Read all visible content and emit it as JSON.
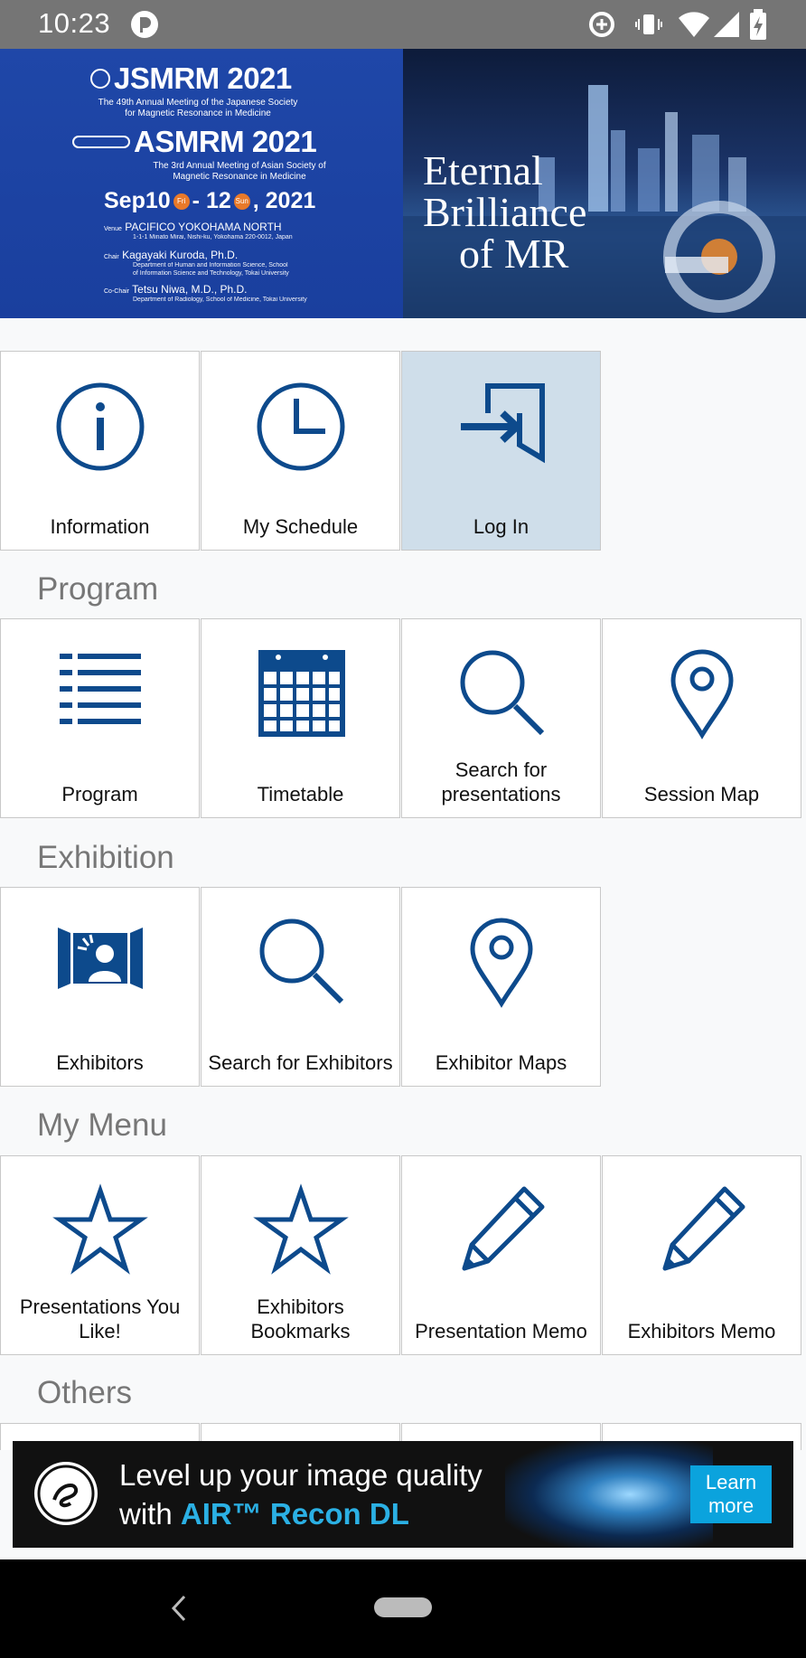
{
  "status_bar": {
    "time": "10:23"
  },
  "banner": {
    "title1": "JSMRM 2021",
    "subtitle1": "The 49th Annual Meeting of the Japanese Society for Magnetic Resonance in Medicine",
    "title2": "ASMRM 2021",
    "subtitle2": "The 3rd Annual Meeting of Asian Society of Magnetic Resonance in Medicine",
    "date_start": "Sep10",
    "day_start": "Fri",
    "date_mid": "- 12",
    "day_end": "Sun",
    "date_end": ", 2021",
    "venue_label": "Venue",
    "venue": "PACIFICO YOKOHAMA NORTH",
    "venue_address": "1-1-1 Minato Mirai, Nishi-ku, Yokohama 220-0012, Japan",
    "chair_label": "Chair",
    "chair": "Kagayaki Kuroda, Ph.D.",
    "chair_affiliation": "Department of Human and Information Science, School of Information Science and Technology, Tokai University",
    "cochair_label": "Co-Chair",
    "cochair": "Tetsu Niwa, M.D., Ph.D.",
    "cochair_affiliation": "Department of Radiology, School of Medicine, Tokai University",
    "tagline_1": "Eternal",
    "tagline_2": "Brilliance",
    "tagline_3": "of MR"
  },
  "top_menu": [
    {
      "label": "Information",
      "icon": "info-icon"
    },
    {
      "label": "My Schedule",
      "icon": "clock-icon"
    },
    {
      "label": "Log In",
      "icon": "login-icon",
      "active": true
    }
  ],
  "sections": {
    "program": {
      "title": "Program",
      "items": [
        {
          "label": "Program",
          "icon": "list-icon"
        },
        {
          "label": "Timetable",
          "icon": "calendar-icon"
        },
        {
          "label": "Search for presentations",
          "icon": "search-icon"
        },
        {
          "label": "Session Map",
          "icon": "map-pin-icon"
        }
      ]
    },
    "exhibition": {
      "title": "Exhibition",
      "items": [
        {
          "label": "Exhibitors",
          "icon": "exhibitor-booth-icon"
        },
        {
          "label": "Search for Exhibitors",
          "icon": "search-icon"
        },
        {
          "label": "Exhibitor Maps",
          "icon": "map-pin-icon"
        }
      ]
    },
    "my_menu": {
      "title": "My Menu",
      "items": [
        {
          "label": "Presentations You Like!",
          "icon": "star-icon"
        },
        {
          "label": "Exhibitors Bookmarks",
          "icon": "star-icon"
        },
        {
          "label": "Presentation Memo",
          "icon": "pencil-icon"
        },
        {
          "label": "Exhibitors Memo",
          "icon": "pencil-icon"
        }
      ]
    },
    "others": {
      "title": "Others"
    }
  },
  "ad": {
    "line1": "Level up your image quality",
    "line2_prefix": "with ",
    "line2_highlight": "AIR™ Recon DL",
    "cta": "Learn more"
  },
  "colors": {
    "icon_blue": "#0d4a8c",
    "tile_active_bg": "#cfdeea",
    "section_text": "#777777",
    "ad_accent": "#2bb0e4"
  }
}
